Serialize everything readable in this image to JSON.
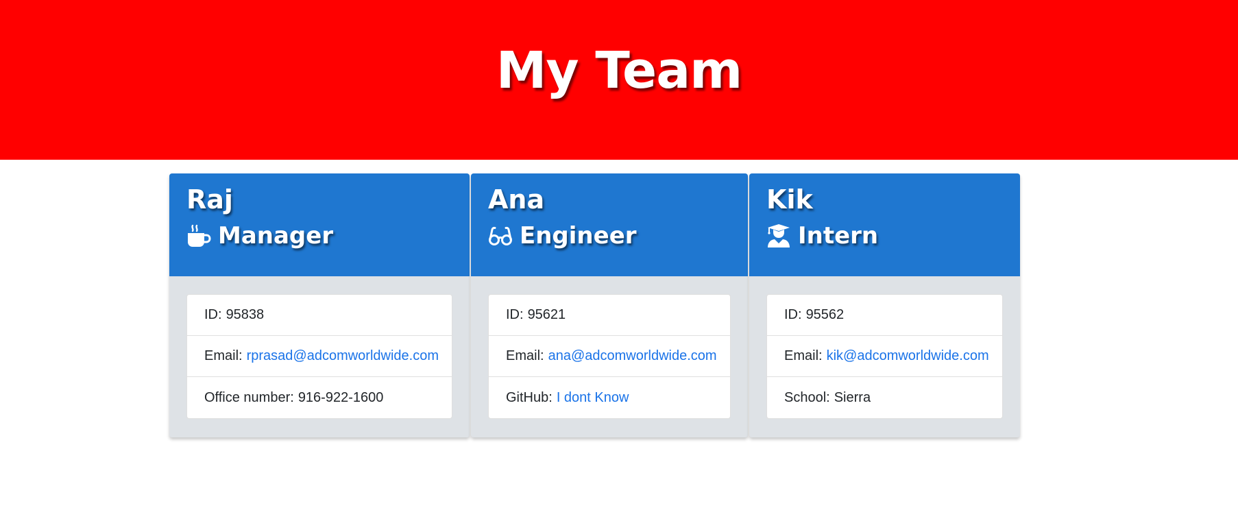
{
  "header": {
    "title": "My Team"
  },
  "members": [
    {
      "name": "Raj",
      "role": "Manager",
      "role_icon": "mug-hot-icon",
      "id_label": "ID:",
      "id": "95838",
      "email_label": "Email:",
      "email": "rprasad@adcomworldwide.com",
      "extra_label": "Office number:",
      "extra_value": "916-922-1600"
    },
    {
      "name": "Ana",
      "role": "Engineer",
      "role_icon": "glasses-icon",
      "id_label": "ID:",
      "id": "95621",
      "email_label": "Email:",
      "email": "ana@adcomworldwide.com",
      "extra_label": "GitHub:",
      "extra_value": "I dont Know"
    },
    {
      "name": "Kik",
      "role": "Intern",
      "role_icon": "user-graduate-icon",
      "id_label": "ID:",
      "id": "95562",
      "email_label": "Email:",
      "email": "kik@adcomworldwide.com",
      "extra_label": "School:",
      "extra_value": "Sierra"
    }
  ],
  "colors": {
    "header_bg": "#ff0000",
    "card_header_bg": "#1f77d0",
    "card_body_bg": "#dee2e6",
    "link": "#1a73e8"
  }
}
